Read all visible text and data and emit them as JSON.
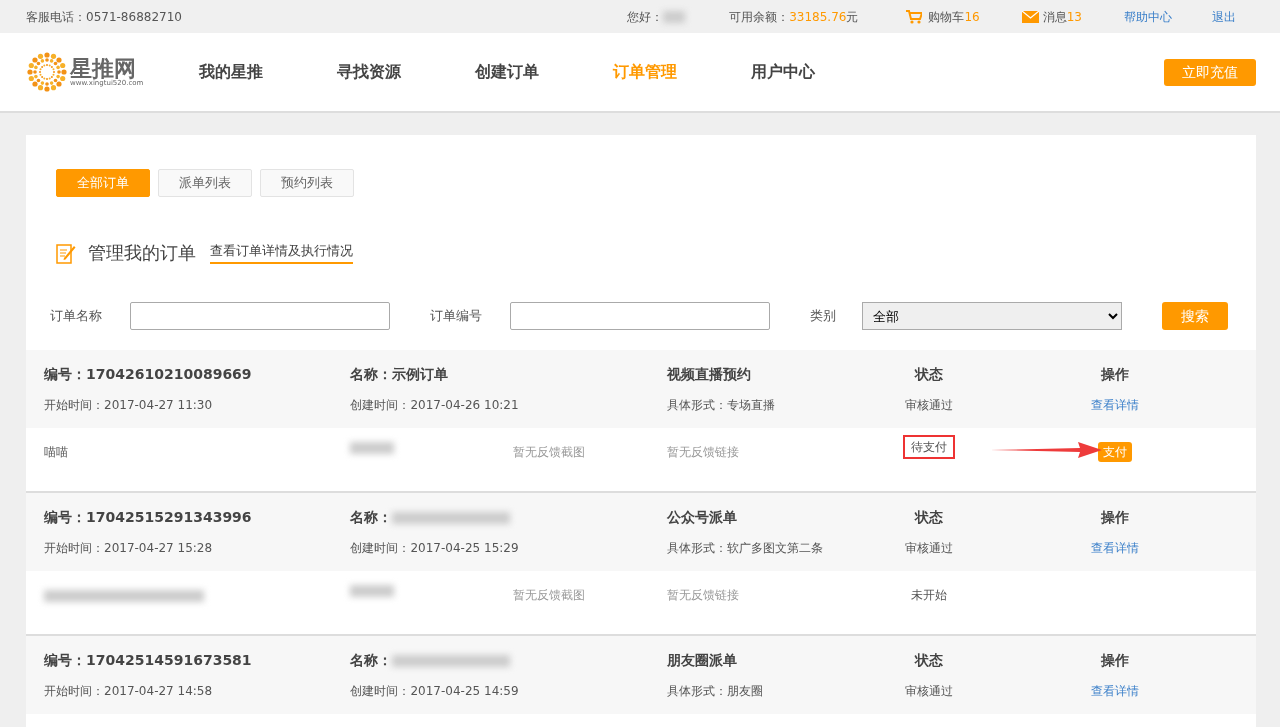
{
  "topbar": {
    "phone": "客服电话：0571-86882710",
    "greeting": "您好：",
    "greeting_redacted": true,
    "balance_label": "可用余额：",
    "balance": "33185.76",
    "balance_unit": "元",
    "cart_label": "购物车",
    "cart_count": "16",
    "msg_label": "消息",
    "msg_count": "13",
    "links": [
      "帮助中心",
      "退出"
    ]
  },
  "header": {
    "logo_name": "星推网",
    "logo_url": "www.xingtui520.com",
    "nav": [
      {
        "label": "我的星推",
        "selected": false
      },
      {
        "label": "寻找资源",
        "selected": false
      },
      {
        "label": "创建订单",
        "selected": false
      },
      {
        "label": "订单管理",
        "selected": true
      },
      {
        "label": "用户中心",
        "selected": false
      }
    ],
    "recharge": "立即充值"
  },
  "tabs": [
    {
      "label": "全部订单",
      "selected": true
    },
    {
      "label": "派单列表",
      "selected": false
    },
    {
      "label": "预约列表",
      "selected": false
    }
  ],
  "section": {
    "title": "管理我的订单",
    "link": "查看订单详情及执行情况"
  },
  "filters": {
    "name_label": "订单名称",
    "number_label": "订单编号",
    "category_label": "类别",
    "category_value": "全部",
    "search": "搜索"
  },
  "orders": [
    {
      "number": "编号：17042610210089669",
      "name": "名称：示例订单",
      "name_redacted": false,
      "type": "视频直播预约",
      "status_label": "状态",
      "action_label": "操作",
      "start": "开始时间：2017-04-27 11:30",
      "created": "创建时间：2017-04-26 10:21",
      "form": "具体形式：专场直播",
      "status": "审核通过",
      "action": "查看详情",
      "detail": {
        "account": "喵喵",
        "account_redacted": false,
        "price_redacted": true,
        "screenshot": "暂无反馈截图",
        "link": "暂无反馈链接",
        "status": "待支付",
        "highlighted": true,
        "arrow": true,
        "button": "支付"
      }
    },
    {
      "number": "编号：17042515291343996",
      "name": "名称：",
      "name_redacted": true,
      "type": "公众号派单",
      "status_label": "状态",
      "action_label": "操作",
      "start": "开始时间：2017-04-27 15:28",
      "created": "创建时间：2017-04-25 15:29",
      "form": "具体形式：软广多图文第二条",
      "status": "审核通过",
      "action": "查看详情",
      "detail": {
        "account_redacted": true,
        "price_redacted": true,
        "screenshot": "暂无反馈截图",
        "link": "暂无反馈链接",
        "status": "未开始",
        "highlighted": false,
        "arrow": false
      }
    },
    {
      "number": "编号：17042514591673581",
      "name": "名称：",
      "name_redacted": true,
      "type": "朋友圈派单",
      "status_label": "状态",
      "action_label": "操作",
      "start": "开始时间：2017-04-27 14:58",
      "created": "创建时间：2017-04-25 14:59",
      "form": "具体形式：朋友圈",
      "status": "审核通过",
      "action": "查看详情"
    }
  ]
}
